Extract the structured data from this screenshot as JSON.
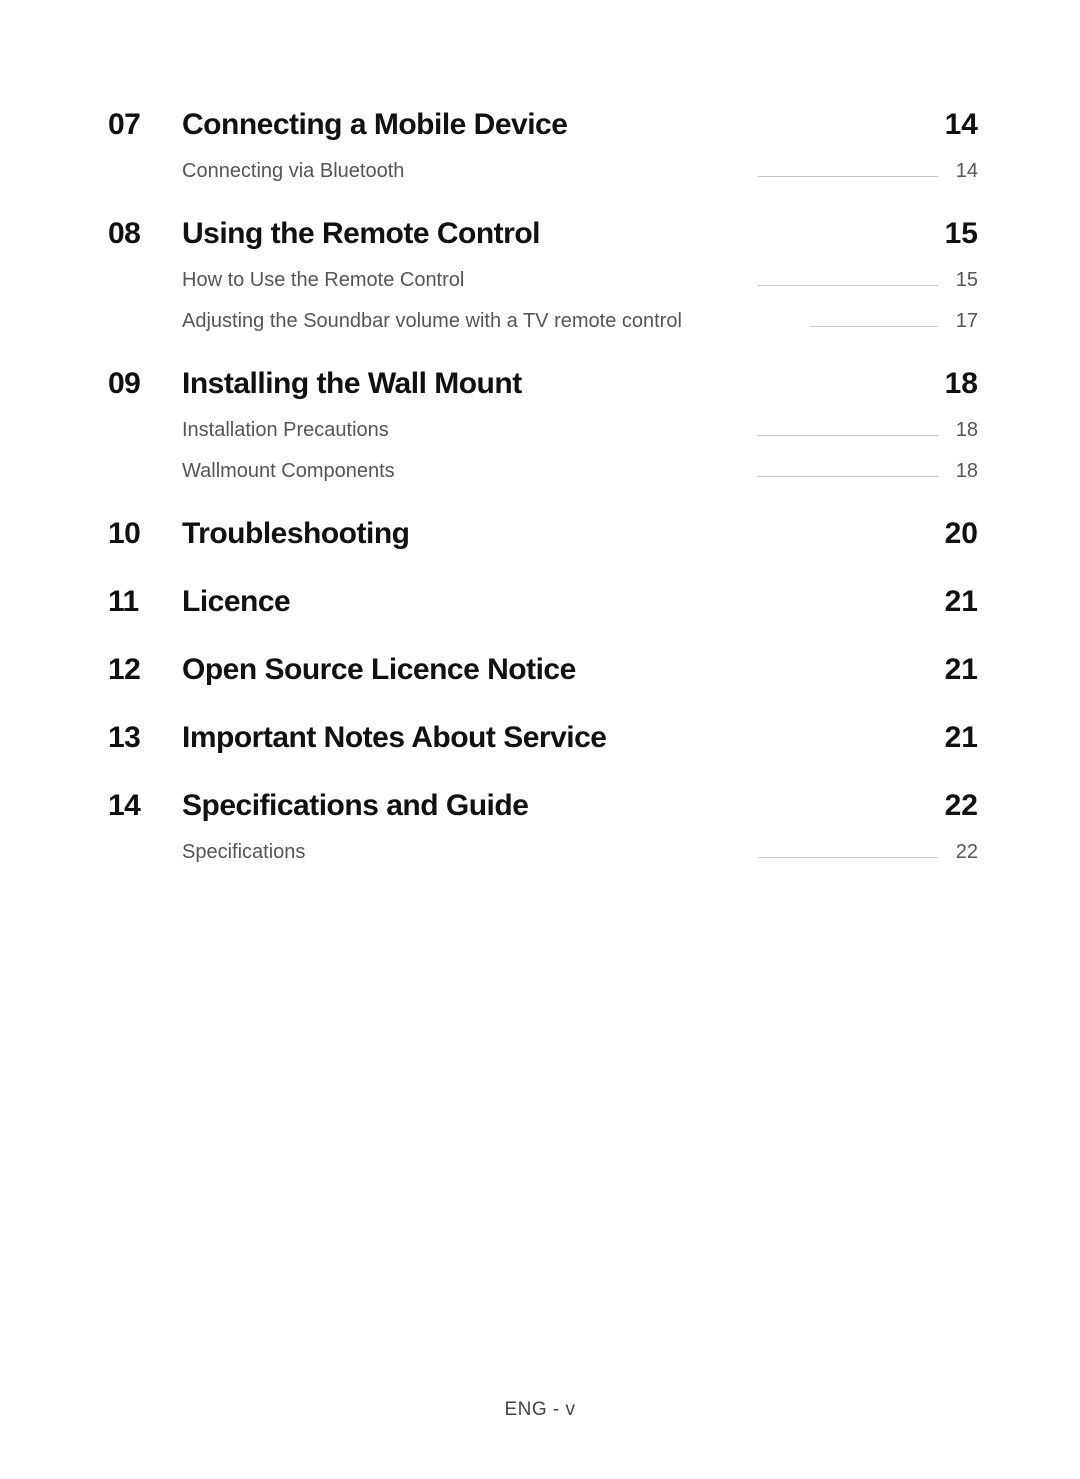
{
  "toc": [
    {
      "number": "07",
      "title": "Connecting a Mobile Device",
      "page": "14",
      "subs": [
        {
          "title": "Connecting via Bluetooth",
          "page": "14"
        }
      ]
    },
    {
      "number": "08",
      "title": "Using the Remote Control",
      "page": "15",
      "subs": [
        {
          "title": "How to Use the Remote Control",
          "page": "15"
        },
        {
          "title": "Adjusting the Soundbar volume with a TV remote control",
          "page": "17"
        }
      ]
    },
    {
      "number": "09",
      "title": "Installing the Wall Mount",
      "page": "18",
      "subs": [
        {
          "title": "Installation Precautions",
          "page": "18"
        },
        {
          "title": "Wallmount Components",
          "page": "18"
        }
      ]
    },
    {
      "number": "10",
      "title": "Troubleshooting",
      "page": "20",
      "subs": []
    },
    {
      "number": "11",
      "title": "Licence",
      "page": "21",
      "subs": []
    },
    {
      "number": "12",
      "title": "Open Source Licence Notice",
      "page": "21",
      "subs": []
    },
    {
      "number": "13",
      "title": "Important Notes About Service",
      "page": "21",
      "subs": []
    },
    {
      "number": "14",
      "title": "Specifications and Guide",
      "page": "22",
      "subs": [
        {
          "title": "Specifications",
          "page": "22"
        }
      ]
    }
  ],
  "footer": "ENG - v"
}
